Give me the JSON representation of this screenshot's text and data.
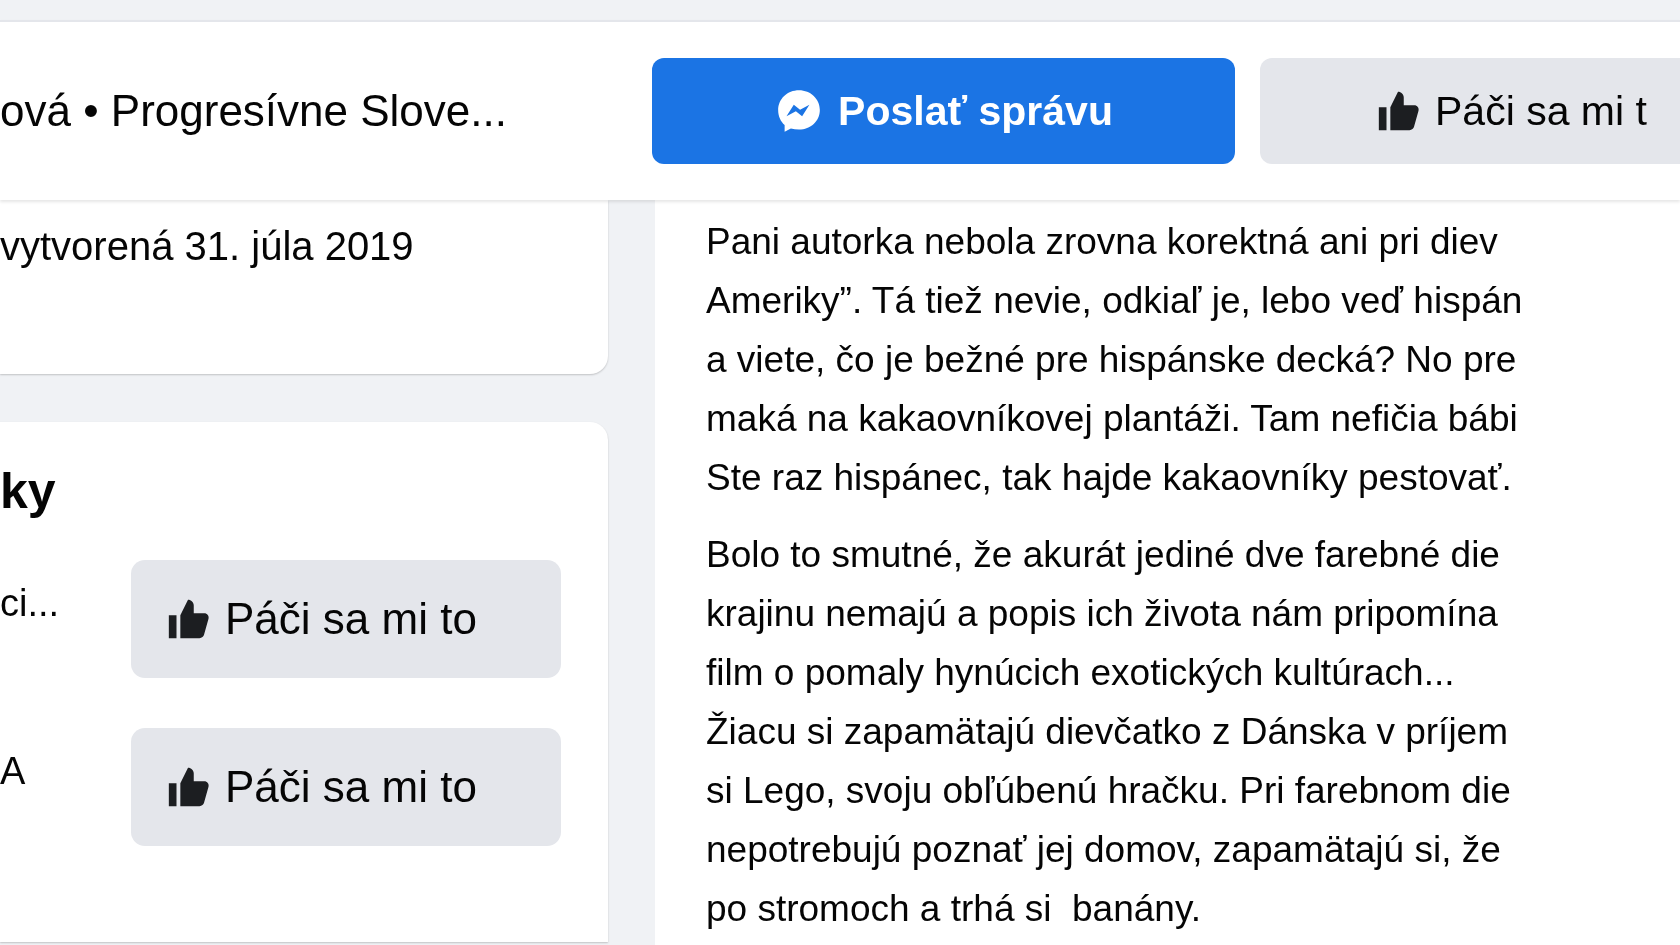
{
  "header": {
    "page_name": "ová • Progresívne Slove...",
    "message_button": "Poslať správu",
    "like_button": "Páči sa mi t"
  },
  "about_card": {
    "created": "vytvorená 31. júla 2019"
  },
  "liked_pages_card": {
    "title": "ky",
    "items": [
      {
        "name": "ci...",
        "button": "Páči sa mi to"
      },
      {
        "name": "A",
        "button": "Páči sa mi to"
      }
    ]
  },
  "post": {
    "paragraphs": [
      [
        "Pani autorka nebola zrovna korektná ani pri diev",
        "Ameriky”. Tá tiež nevie, odkiaľ je, lebo veď hispán",
        "a viete, čo je bežné pre hispánske decká? No pre",
        "maká na kakaovníkovej plantáži. Tam nefičia bábi",
        "Ste raz hispánec, tak hajde kakaovníky pestovať."
      ],
      [
        "Bolo to smutné, že akurát jediné dve farebné die",
        "krajinu nemajú a popis ich života nám pripomína",
        "film o pomaly hynúcich exotických kultúrach...",
        "Žiacu si zapamätajú dievčatko z Dánska v príjem",
        "si Lego, svoju obľúbenú hračku. Pri farebnom die",
        "nepotrebujú poznať jej domov, zapamätajú si, že",
        "po stromoch a trhá si  banány."
      ]
    ]
  }
}
